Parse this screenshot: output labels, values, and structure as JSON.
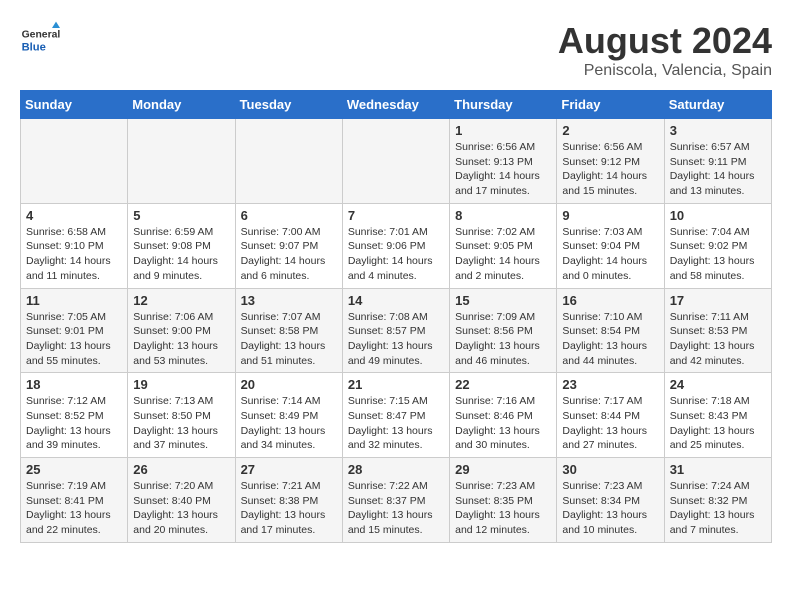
{
  "header": {
    "logo_general": "General",
    "logo_blue": "Blue",
    "month_title": "August 2024",
    "subtitle": "Peniscola, Valencia, Spain"
  },
  "weekdays": [
    "Sunday",
    "Monday",
    "Tuesday",
    "Wednesday",
    "Thursday",
    "Friday",
    "Saturday"
  ],
  "weeks": [
    [
      {
        "day": "",
        "info": ""
      },
      {
        "day": "",
        "info": ""
      },
      {
        "day": "",
        "info": ""
      },
      {
        "day": "",
        "info": ""
      },
      {
        "day": "1",
        "info": "Sunrise: 6:56 AM\nSunset: 9:13 PM\nDaylight: 14 hours\nand 17 minutes."
      },
      {
        "day": "2",
        "info": "Sunrise: 6:56 AM\nSunset: 9:12 PM\nDaylight: 14 hours\nand 15 minutes."
      },
      {
        "day": "3",
        "info": "Sunrise: 6:57 AM\nSunset: 9:11 PM\nDaylight: 14 hours\nand 13 minutes."
      }
    ],
    [
      {
        "day": "4",
        "info": "Sunrise: 6:58 AM\nSunset: 9:10 PM\nDaylight: 14 hours\nand 11 minutes."
      },
      {
        "day": "5",
        "info": "Sunrise: 6:59 AM\nSunset: 9:08 PM\nDaylight: 14 hours\nand 9 minutes."
      },
      {
        "day": "6",
        "info": "Sunrise: 7:00 AM\nSunset: 9:07 PM\nDaylight: 14 hours\nand 6 minutes."
      },
      {
        "day": "7",
        "info": "Sunrise: 7:01 AM\nSunset: 9:06 PM\nDaylight: 14 hours\nand 4 minutes."
      },
      {
        "day": "8",
        "info": "Sunrise: 7:02 AM\nSunset: 9:05 PM\nDaylight: 14 hours\nand 2 minutes."
      },
      {
        "day": "9",
        "info": "Sunrise: 7:03 AM\nSunset: 9:04 PM\nDaylight: 14 hours\nand 0 minutes."
      },
      {
        "day": "10",
        "info": "Sunrise: 7:04 AM\nSunset: 9:02 PM\nDaylight: 13 hours\nand 58 minutes."
      }
    ],
    [
      {
        "day": "11",
        "info": "Sunrise: 7:05 AM\nSunset: 9:01 PM\nDaylight: 13 hours\nand 55 minutes."
      },
      {
        "day": "12",
        "info": "Sunrise: 7:06 AM\nSunset: 9:00 PM\nDaylight: 13 hours\nand 53 minutes."
      },
      {
        "day": "13",
        "info": "Sunrise: 7:07 AM\nSunset: 8:58 PM\nDaylight: 13 hours\nand 51 minutes."
      },
      {
        "day": "14",
        "info": "Sunrise: 7:08 AM\nSunset: 8:57 PM\nDaylight: 13 hours\nand 49 minutes."
      },
      {
        "day": "15",
        "info": "Sunrise: 7:09 AM\nSunset: 8:56 PM\nDaylight: 13 hours\nand 46 minutes."
      },
      {
        "day": "16",
        "info": "Sunrise: 7:10 AM\nSunset: 8:54 PM\nDaylight: 13 hours\nand 44 minutes."
      },
      {
        "day": "17",
        "info": "Sunrise: 7:11 AM\nSunset: 8:53 PM\nDaylight: 13 hours\nand 42 minutes."
      }
    ],
    [
      {
        "day": "18",
        "info": "Sunrise: 7:12 AM\nSunset: 8:52 PM\nDaylight: 13 hours\nand 39 minutes."
      },
      {
        "day": "19",
        "info": "Sunrise: 7:13 AM\nSunset: 8:50 PM\nDaylight: 13 hours\nand 37 minutes."
      },
      {
        "day": "20",
        "info": "Sunrise: 7:14 AM\nSunset: 8:49 PM\nDaylight: 13 hours\nand 34 minutes."
      },
      {
        "day": "21",
        "info": "Sunrise: 7:15 AM\nSunset: 8:47 PM\nDaylight: 13 hours\nand 32 minutes."
      },
      {
        "day": "22",
        "info": "Sunrise: 7:16 AM\nSunset: 8:46 PM\nDaylight: 13 hours\nand 30 minutes."
      },
      {
        "day": "23",
        "info": "Sunrise: 7:17 AM\nSunset: 8:44 PM\nDaylight: 13 hours\nand 27 minutes."
      },
      {
        "day": "24",
        "info": "Sunrise: 7:18 AM\nSunset: 8:43 PM\nDaylight: 13 hours\nand 25 minutes."
      }
    ],
    [
      {
        "day": "25",
        "info": "Sunrise: 7:19 AM\nSunset: 8:41 PM\nDaylight: 13 hours\nand 22 minutes."
      },
      {
        "day": "26",
        "info": "Sunrise: 7:20 AM\nSunset: 8:40 PM\nDaylight: 13 hours\nand 20 minutes."
      },
      {
        "day": "27",
        "info": "Sunrise: 7:21 AM\nSunset: 8:38 PM\nDaylight: 13 hours\nand 17 minutes."
      },
      {
        "day": "28",
        "info": "Sunrise: 7:22 AM\nSunset: 8:37 PM\nDaylight: 13 hours\nand 15 minutes."
      },
      {
        "day": "29",
        "info": "Sunrise: 7:23 AM\nSunset: 8:35 PM\nDaylight: 13 hours\nand 12 minutes."
      },
      {
        "day": "30",
        "info": "Sunrise: 7:23 AM\nSunset: 8:34 PM\nDaylight: 13 hours\nand 10 minutes."
      },
      {
        "day": "31",
        "info": "Sunrise: 7:24 AM\nSunset: 8:32 PM\nDaylight: 13 hours\nand 7 minutes."
      }
    ]
  ]
}
